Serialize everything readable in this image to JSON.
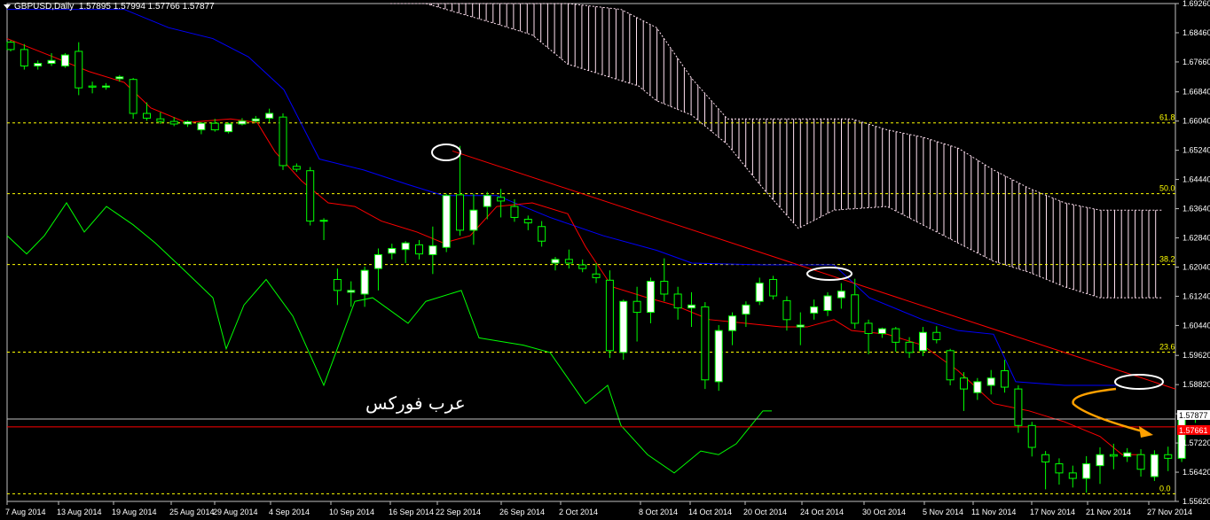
{
  "header": {
    "symbol": "GBPUSD,Daily",
    "ohlc": "1.57895 1.57994 1.57766 1.57877"
  },
  "watermark": "عرب فوركس",
  "colors": {
    "background": "#000000",
    "grid": "#c0c0c0",
    "bull_candle": "#ffffff",
    "candle_outline": "#00ff00",
    "tenkan": "#ff0000",
    "kijun": "#0000ff",
    "chikou": "#00ff00",
    "fib": "#ffff00",
    "cloud_hatch": "#ffe0f0",
    "trendline": "#ff0000",
    "ellipse": "#ffffff",
    "arrow": "#ffa000",
    "bid_line": "#c0c0c0",
    "ask_line": "#ff0000"
  },
  "chart_data": {
    "type": "candlestick",
    "symbol": "GBPUSD",
    "timeframe": "Daily",
    "ylim": [
      1.5562,
      1.6926
    ],
    "y_ticks": [
      "1.69260",
      "1.68460",
      "1.67660",
      "1.66840",
      "1.66040",
      "1.65240",
      "1.64440",
      "1.63640",
      "1.62840",
      "1.62040",
      "1.61240",
      "1.60440",
      "1.59620",
      "1.58820",
      "1.58020",
      "1.57220",
      "1.56420",
      "1.55620"
    ],
    "x_ticks": [
      "7 Aug 2014",
      "13 Aug 2014",
      "19 Aug 2014",
      "25 Aug 2014",
      "29 Aug 2014",
      "4 Sep 2014",
      "10 Sep 2014",
      "16 Sep 2014",
      "22 Sep 2014",
      "26 Sep 2014",
      "2 Oct 2014",
      "8 Oct 2014",
      "14 Oct 2014",
      "20 Oct 2014",
      "24 Oct 2014",
      "30 Oct 2014",
      "5 Nov 2014",
      "11 Nov 2014",
      "17 Nov 2014",
      "21 Nov 2014",
      "27 Nov 2014"
    ],
    "price_tags": [
      {
        "label": "1.57877",
        "price": 1.57877,
        "kind": "bid"
      },
      {
        "label": "1.57661",
        "price": 1.57661,
        "kind": "ask"
      }
    ],
    "fibonacci": [
      {
        "label": "0.0",
        "price": 1.5583
      },
      {
        "label": "23.6",
        "price": 1.5971
      },
      {
        "label": "38.2",
        "price": 1.6211
      },
      {
        "label": "50.0",
        "price": 1.6405
      },
      {
        "label": "61.8",
        "price": 1.6599
      }
    ],
    "candles": [
      [
        1.682,
        1.6825,
        1.6795,
        1.68
      ],
      [
        1.68,
        1.6815,
        1.6745,
        1.6755
      ],
      [
        1.6755,
        1.677,
        1.6745,
        1.6762
      ],
      [
        1.6762,
        1.679,
        1.6755,
        1.677
      ],
      [
        1.6755,
        1.679,
        1.675,
        1.6785
      ],
      [
        1.6795,
        1.682,
        1.6675,
        1.6695
      ],
      [
        1.67,
        1.6712,
        1.668,
        1.6697
      ],
      [
        1.6697,
        1.6708,
        1.669,
        1.67
      ],
      [
        1.672,
        1.673,
        1.6712,
        1.6725
      ],
      [
        1.6718,
        1.6722,
        1.661,
        1.6625
      ],
      [
        1.6625,
        1.6655,
        1.6605,
        1.6612
      ],
      [
        1.661,
        1.6628,
        1.6596,
        1.6603
      ],
      [
        1.6603,
        1.6615,
        1.659,
        1.6596
      ],
      [
        1.6596,
        1.6606,
        1.6588,
        1.6602
      ],
      [
        1.658,
        1.6601,
        1.6568,
        1.6598
      ],
      [
        1.6598,
        1.661,
        1.6575,
        1.658
      ],
      [
        1.6575,
        1.66,
        1.657,
        1.6596
      ],
      [
        1.6596,
        1.6612,
        1.6592,
        1.6604
      ],
      [
        1.6604,
        1.6618,
        1.6598,
        1.661
      ],
      [
        1.6612,
        1.6638,
        1.66,
        1.6625
      ],
      [
        1.6615,
        1.6625,
        1.647,
        1.6482
      ],
      [
        1.648,
        1.6488,
        1.6465,
        1.6472
      ],
      [
        1.6468,
        1.6478,
        1.6318,
        1.633
      ],
      [
        1.633,
        1.6338,
        1.6278,
        1.6332
      ],
      [
        1.617,
        1.62,
        1.61,
        1.614
      ],
      [
        1.6135,
        1.6165,
        1.6095,
        1.614
      ],
      [
        1.613,
        1.6205,
        1.6095,
        1.6195
      ],
      [
        1.62,
        1.6255,
        1.614,
        1.6238
      ],
      [
        1.6242,
        1.6268,
        1.6225,
        1.6255
      ],
      [
        1.6252,
        1.6275,
        1.6215,
        1.627
      ],
      [
        1.6265,
        1.6278,
        1.6225,
        1.624
      ],
      [
        1.6238,
        1.6315,
        1.6185,
        1.6262
      ],
      [
        1.6258,
        1.6405,
        1.6245,
        1.64
      ],
      [
        1.6402,
        1.6536,
        1.629,
        1.6305
      ],
      [
        1.6305,
        1.6405,
        1.6265,
        1.636
      ],
      [
        1.637,
        1.641,
        1.6335,
        1.64
      ],
      [
        1.6395,
        1.6418,
        1.634,
        1.6385
      ],
      [
        1.637,
        1.639,
        1.6328,
        1.634
      ],
      [
        1.6335,
        1.6345,
        1.6305,
        1.6325
      ],
      [
        1.6315,
        1.633,
        1.626,
        1.6275
      ],
      [
        1.6215,
        1.6232,
        1.6195,
        1.6225
      ],
      [
        1.6225,
        1.6252,
        1.62,
        1.6215
      ],
      [
        1.621,
        1.6225,
        1.619,
        1.62
      ],
      [
        1.6185,
        1.6215,
        1.616,
        1.6175
      ],
      [
        1.6168,
        1.6195,
        1.5955,
        1.5975
      ],
      [
        1.597,
        1.6115,
        1.595,
        1.611
      ],
      [
        1.611,
        1.615,
        1.6,
        1.608
      ],
      [
        1.608,
        1.6175,
        1.605,
        1.6165
      ],
      [
        1.6165,
        1.6228,
        1.611,
        1.613
      ],
      [
        1.613,
        1.615,
        1.606,
        1.6092
      ],
      [
        1.6092,
        1.6135,
        1.604,
        1.61
      ],
      [
        1.6095,
        1.6108,
        1.587,
        1.5895
      ],
      [
        1.589,
        1.6045,
        1.5865,
        1.603
      ],
      [
        1.603,
        1.608,
        1.599,
        1.607
      ],
      [
        1.6075,
        1.611,
        1.604,
        1.61
      ],
      [
        1.611,
        1.6175,
        1.61,
        1.616
      ],
      [
        1.617,
        1.618,
        1.6115,
        1.6125
      ],
      [
        1.6112,
        1.6124,
        1.603,
        1.606
      ],
      [
        1.604,
        1.608,
        1.599,
        1.6045
      ],
      [
        1.6078,
        1.6115,
        1.606,
        1.6095
      ],
      [
        1.6085,
        1.6135,
        1.607,
        1.6125
      ],
      [
        1.612,
        1.616,
        1.609,
        1.6138
      ],
      [
        1.6128,
        1.6172,
        1.6035,
        1.605
      ],
      [
        1.605,
        1.606,
        1.5965,
        1.6022
      ],
      [
        1.6022,
        1.6038,
        1.601,
        1.6035
      ],
      [
        1.6035,
        1.604,
        1.5972,
        1.5998
      ],
      [
        1.5998,
        1.6012,
        1.5955,
        1.597
      ],
      [
        1.5975,
        1.604,
        1.596,
        1.6025
      ],
      [
        1.6025,
        1.6042,
        1.5995,
        1.6005
      ],
      [
        1.5975,
        1.598,
        1.588,
        1.5895
      ],
      [
        1.59,
        1.5916,
        1.581,
        1.587
      ],
      [
        1.586,
        1.59,
        1.584,
        1.589
      ],
      [
        1.588,
        1.5922,
        1.5855,
        1.59
      ],
      [
        1.592,
        1.595,
        1.586,
        1.5875
      ],
      [
        1.587,
        1.588,
        1.575,
        1.577
      ],
      [
        1.577,
        1.578,
        1.5685,
        1.571
      ],
      [
        1.569,
        1.57,
        1.5595,
        1.567
      ],
      [
        1.5665,
        1.568,
        1.5608,
        1.564
      ],
      [
        1.564,
        1.566,
        1.56,
        1.5625
      ],
      [
        1.5625,
        1.5686,
        1.5586,
        1.5665
      ],
      [
        1.566,
        1.571,
        1.561,
        1.569
      ],
      [
        1.569,
        1.572,
        1.565,
        1.5686
      ],
      [
        1.5685,
        1.5708,
        1.567,
        1.5695
      ],
      [
        1.569,
        1.5705,
        1.563,
        1.565
      ],
      [
        1.563,
        1.5702,
        1.5618,
        1.569
      ],
      [
        1.569,
        1.5712,
        1.5645,
        1.568
      ],
      [
        1.568,
        1.58,
        1.567,
        1.5788
      ],
      [
        1.579,
        1.5799,
        1.5777,
        1.5788
      ]
    ]
  }
}
